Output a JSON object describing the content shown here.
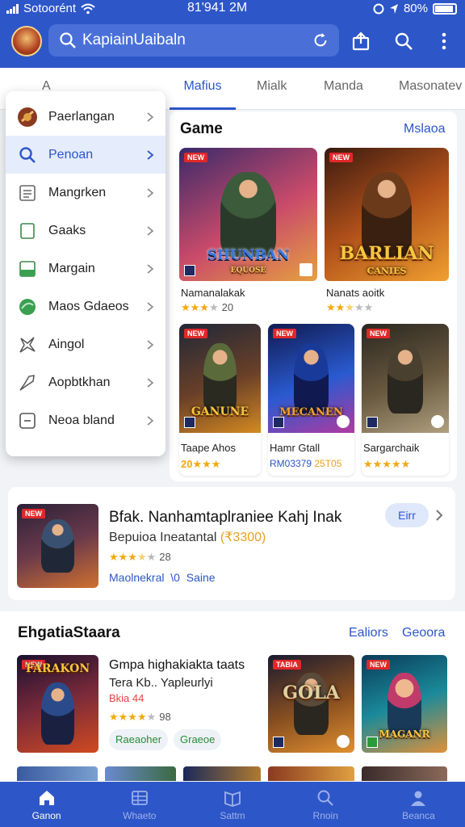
{
  "status": {
    "carrier": "Sotoorént",
    "time": "81'941 2M",
    "battery": "80%"
  },
  "header": {
    "search_value": "KapiainUaibaln",
    "avatar_icon": "profile-avatar-icon"
  },
  "tabs": [
    {
      "label": "A",
      "active": false
    },
    {
      "label": "Mafius",
      "active": true
    },
    {
      "label": "Mialk",
      "active": false
    },
    {
      "label": "Manda",
      "active": false
    },
    {
      "label": "Masonatev",
      "active": false
    }
  ],
  "menu": [
    {
      "label": "Paerlangan",
      "icon": "game-shield-icon",
      "active": false
    },
    {
      "label": "Penoan",
      "icon": "search-icon",
      "active": true
    },
    {
      "label": "Mangrken",
      "icon": "list-icon",
      "active": false
    },
    {
      "label": "Gaaks",
      "icon": "document-icon",
      "active": false
    },
    {
      "label": "Margain",
      "icon": "calendar-icon",
      "active": false
    },
    {
      "label": "Maos Gdaeos",
      "icon": "globe-icon",
      "active": false
    },
    {
      "label": "Aingol",
      "icon": "star-burst-icon",
      "active": false
    },
    {
      "label": "Aopbtkhan",
      "icon": "rocket-icon",
      "active": false
    },
    {
      "label": "Neoa bland",
      "icon": "minus-box-icon",
      "active": false
    }
  ],
  "games_card": {
    "title": "Game",
    "link": "Mslaoa",
    "large_tiles": [
      {
        "art_title": "SHUNBAN",
        "art_subtitle": "EQUOSE",
        "tag": "NEW",
        "name": "Namanalakak",
        "rating": 3,
        "score": "20",
        "colors": [
          "#3a2a6a",
          "#c94a6a",
          "#e6a040"
        ]
      },
      {
        "art_title": "BARLIAN",
        "art_subtitle": "CANIES",
        "tag": "NEW",
        "name": "Nanats aoitk",
        "rating": 2.5,
        "score": "",
        "colors": [
          "#3a1a10",
          "#b0501a",
          "#f0a030"
        ]
      }
    ],
    "small_tiles": [
      {
        "art_title": "GANUNE",
        "tag": "NEW",
        "name": "Taape Ahos",
        "price": "20",
        "rating": 3,
        "colors": [
          "#202838",
          "#6a4028",
          "#d48a20"
        ]
      },
      {
        "art_title": "MECANEN",
        "tag": "NEW",
        "name": "Hamr Gtall",
        "price": "RM03379",
        "price_extra": "25T05",
        "rating": 0,
        "colors": [
          "#101a50",
          "#2a5ad0",
          "#b03aa0"
        ]
      },
      {
        "art_title": "",
        "tag": "NEW",
        "name": "Sargarchaik",
        "price": "",
        "rating": 5,
        "colors": [
          "#2a2620",
          "#6a5a40",
          "#b0a080"
        ]
      }
    ]
  },
  "featured": {
    "title": "Bfak. Nanhamtaplraniee Kahj Inak",
    "subtitle": "Bepuioa Ineatantal",
    "price": "(₹3300)",
    "rating": 3.5,
    "score": "28",
    "meta_left": "Maolnekral",
    "meta_mid": "\\0",
    "meta_right": "Saine",
    "pill": "Eirr",
    "tag": "NEW"
  },
  "section2": {
    "heading": "EhgatiaStaara",
    "link_1": "Ealiors",
    "link_2": "Geoora",
    "item": {
      "art_title": "FARAKON",
      "title": "Gmpa highakiakta taats",
      "line2": "Tera Kb.. Yapleurlyi",
      "line3": "Bkia 44",
      "rating": 4,
      "score": "98",
      "chip_1": "Raeaoher",
      "chip_2": "Graeoe",
      "tag": "NEW"
    },
    "side_tiles": [
      {
        "art_title": "GOLA",
        "tag": "TABIA",
        "colors": [
          "#1a1a30",
          "#8a5020",
          "#e09030"
        ]
      },
      {
        "art_title": "MAGANR",
        "tag": "NEW",
        "colors": [
          "#0a3a5a",
          "#1a8a9a",
          "#e0903a"
        ]
      }
    ]
  },
  "bottom_nav": [
    {
      "label": "Ganon",
      "icon": "home-icon",
      "active": true
    },
    {
      "label": "Whaeto",
      "icon": "grid-icon",
      "active": false
    },
    {
      "label": "Sattm",
      "icon": "book-icon",
      "active": false
    },
    {
      "label": "Rnoin",
      "icon": "search-icon",
      "active": false
    },
    {
      "label": "Beanca",
      "icon": "person-icon",
      "active": false
    }
  ],
  "colors": {
    "brand": "#2d56c8",
    "star": "#f2a90e",
    "tag_red": "#e02828"
  }
}
